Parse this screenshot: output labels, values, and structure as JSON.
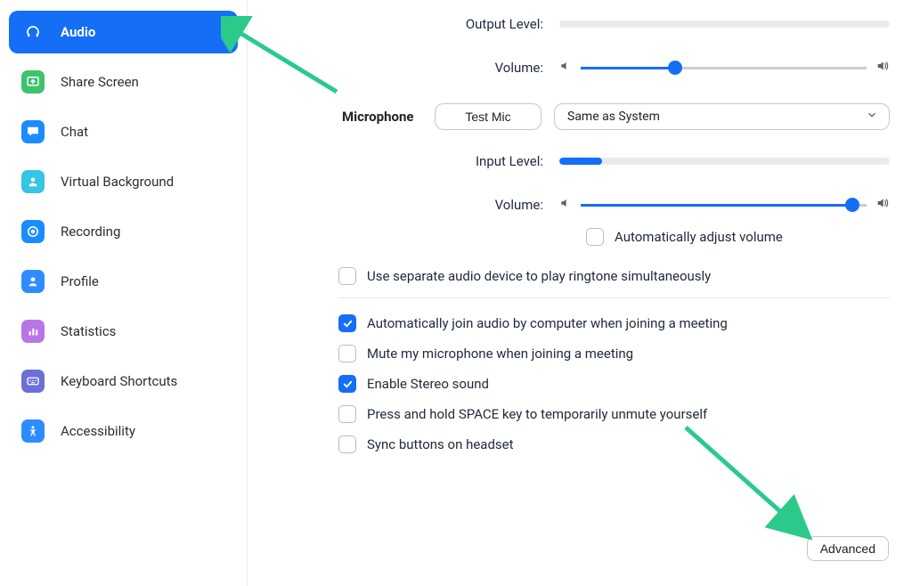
{
  "sidebar": {
    "items": [
      {
        "label": "Audio"
      },
      {
        "label": "Share Screen"
      },
      {
        "label": "Chat"
      },
      {
        "label": "Virtual Background"
      },
      {
        "label": "Recording"
      },
      {
        "label": "Profile"
      },
      {
        "label": "Statistics"
      },
      {
        "label": "Keyboard Shortcuts"
      },
      {
        "label": "Accessibility"
      }
    ]
  },
  "labels": {
    "output_level": "Output Level:",
    "volume1": "Volume:",
    "microphone": "Microphone",
    "test_mic": "Test Mic",
    "mic_device": "Same as System",
    "input_level": "Input Level:",
    "volume2": "Volume:",
    "auto_adjust": "Automatically adjust volume",
    "separate_ringtone": "Use separate audio device to play ringtone simultaneously",
    "auto_join": "Automatically join audio by computer when joining a meeting",
    "mute_on_join": "Mute my microphone when joining a meeting",
    "stereo": "Enable Stereo sound",
    "space_unmute": "Press and hold SPACE key to temporarily unmute yourself",
    "sync_headset": "Sync buttons on headset",
    "advanced": "Advanced"
  },
  "values": {
    "output_level_pct": 0,
    "output_volume_pct": 33,
    "input_level_pct": 13,
    "input_volume_pct": 95,
    "auto_adjust_checked": false,
    "separate_ringtone_checked": false,
    "auto_join_checked": true,
    "mute_on_join_checked": false,
    "stereo_checked": true,
    "space_unmute_checked": false,
    "sync_headset_checked": false
  },
  "colors": {
    "accent": "#146ef6",
    "arrow": "#2bca8b"
  }
}
